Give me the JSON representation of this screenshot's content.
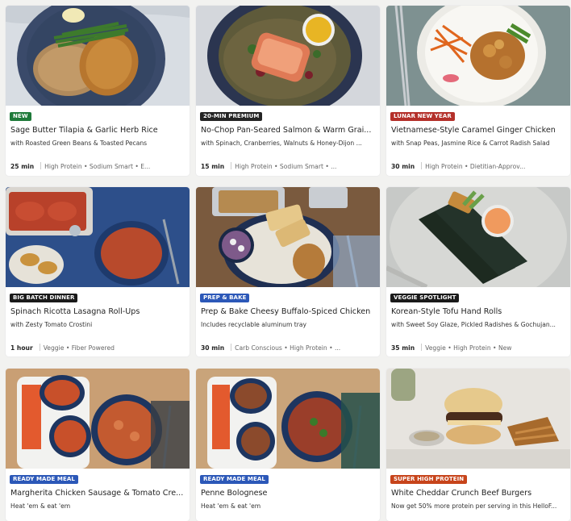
{
  "colors": {
    "new": "#1f7a3a",
    "premium": "#242424",
    "lunar": "#b4302a",
    "dark": "#1a1a1a",
    "prep": "#2c58b8",
    "ready": "#2c58b8",
    "super": "#c7441b"
  },
  "cards": [
    {
      "badge": "NEW",
      "badge_color": "#1f7a3a",
      "title": "Sage Butter Tilapia & Garlic Herb Rice",
      "subtitle": "with Roasted Green Beans & Toasted Pecans",
      "time": "25 min",
      "tags": "High Protein • Sodium Smart • E..."
    },
    {
      "badge": "20-MIN PREMIUM",
      "badge_color": "#242424",
      "title": "No-Chop Pan-Seared Salmon & Warm Grai...",
      "subtitle": "with Spinach, Cranberries, Walnuts & Honey-Dijon ...",
      "time": "15 min",
      "tags": "High Protein • Sodium Smart • ..."
    },
    {
      "badge": "LUNAR NEW YEAR",
      "badge_color": "#b4302a",
      "title": "Vietnamese-Style Caramel Ginger Chicken",
      "subtitle": "with Snap Peas, Jasmine Rice & Carrot Radish Salad",
      "time": "30 min",
      "tags": "High Protein • Dietitian-Approv..."
    },
    {
      "badge": "BIG BATCH DINNER",
      "badge_color": "#1a1a1a",
      "title": "Spinach Ricotta Lasagna Roll-Ups",
      "subtitle": "with Zesty Tomato Crostini",
      "time": "1 hour",
      "tags": "Veggie • Fiber Powered"
    },
    {
      "badge": "PREP & BAKE",
      "badge_color": "#2c58b8",
      "title": "Prep & Bake Cheesy Buffalo-Spiced Chicken",
      "subtitle": "Includes recyclable aluminum tray",
      "time": "30 min",
      "tags": "Carb Conscious • High Protein • ..."
    },
    {
      "badge": "VEGGIE SPOTLIGHT",
      "badge_color": "#1a1a1a",
      "title": "Korean-Style Tofu Hand Rolls",
      "subtitle": "with Sweet Soy Glaze, Pickled Radishes & Gochujan...",
      "time": "35 min",
      "tags": "Veggie • High Protein • New"
    },
    {
      "badge": "READY MADE MEAL",
      "badge_color": "#2c58b8",
      "title": "Margherita Chicken Sausage & Tomato Cre...",
      "subtitle": "Heat 'em & eat 'em",
      "time": "",
      "tags": ""
    },
    {
      "badge": "READY MADE MEAL",
      "badge_color": "#2c58b8",
      "title": "Penne Bolognese",
      "subtitle": "Heat 'em & eat 'em",
      "time": "",
      "tags": ""
    },
    {
      "badge": "SUPER HIGH PROTEIN",
      "badge_color": "#c7441b",
      "title": "White Cheddar Crunch Beef Burgers",
      "subtitle": "Now get 50% more protein per serving in this HelloF...",
      "time": "",
      "tags": ""
    }
  ]
}
